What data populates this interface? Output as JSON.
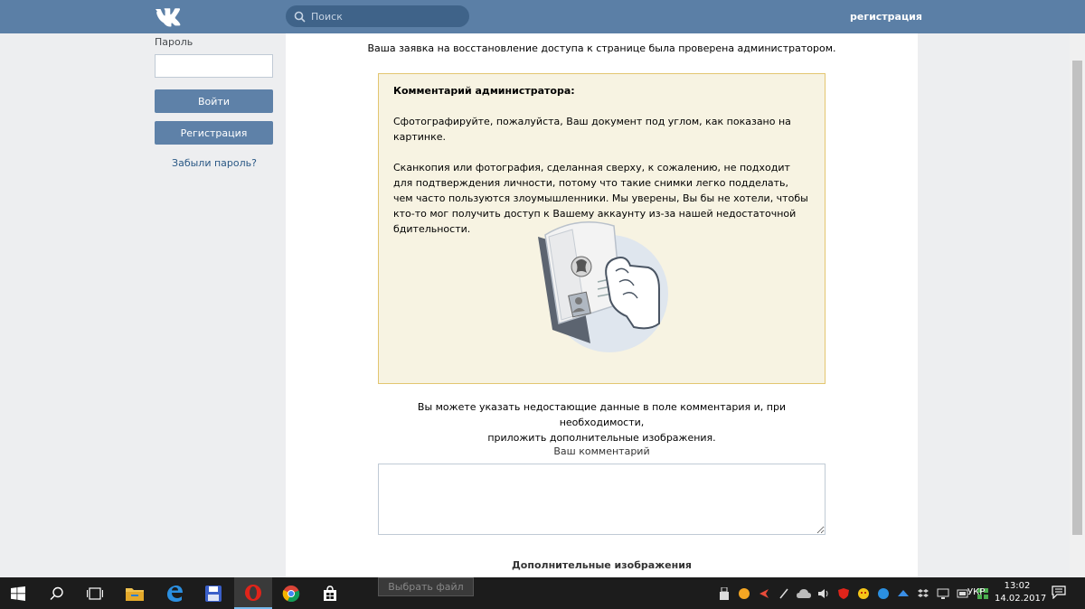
{
  "header": {
    "search_placeholder": "Поиск",
    "register_link": "регистрация"
  },
  "login": {
    "password_label": "Пароль",
    "login_button": "Войти",
    "register_button": "Регистрация",
    "forgot_link": "Забыли пароль?"
  },
  "main": {
    "verified_notice": "Ваша заявка на восстановление доступа к странице была проверена администратором.",
    "admin_comment_title": "Комментарий администратора:",
    "admin_comment_p1": "Сфотографируйте, пожалуйста, Ваш документ под углом, как показано на картинке.",
    "admin_comment_p2": "Сканкопия или фотография, сделанная сверху, к сожалению, не подходит для подтверждения личности, потому что такие снимки легко подделать, чем часто пользуются злоумышленники. Мы уверены, Вы бы не хотели, чтобы кто-то мог получить доступ к Вашему аккаунту из-за нашей недостаточной бдительности.",
    "hint_line1": "Вы можете указать недостающие данные в поле комментария и, при необходимости,",
    "hint_line2": "приложить дополнительные изображения.",
    "your_comment_label": "Ваш комментарий",
    "comment_value": "",
    "extra_images_label": "Дополнительные изображения",
    "choose_file_button": "Выбрать файл"
  },
  "taskbar": {
    "language": "УКР",
    "time": "13:02",
    "date": "14.02.2017",
    "pinned_icons": [
      "windows-start-icon",
      "search-icon",
      "task-view-icon",
      "file-explorer-icon",
      "edge-icon",
      "save-app-icon",
      "opera-icon",
      "chrome-icon",
      "store-icon"
    ]
  },
  "colors": {
    "header": "#5b7fa6",
    "button": "#5e81a8",
    "comment_bg": "#f7f3e2",
    "comment_border": "#e3c670",
    "link": "#2a5885"
  }
}
